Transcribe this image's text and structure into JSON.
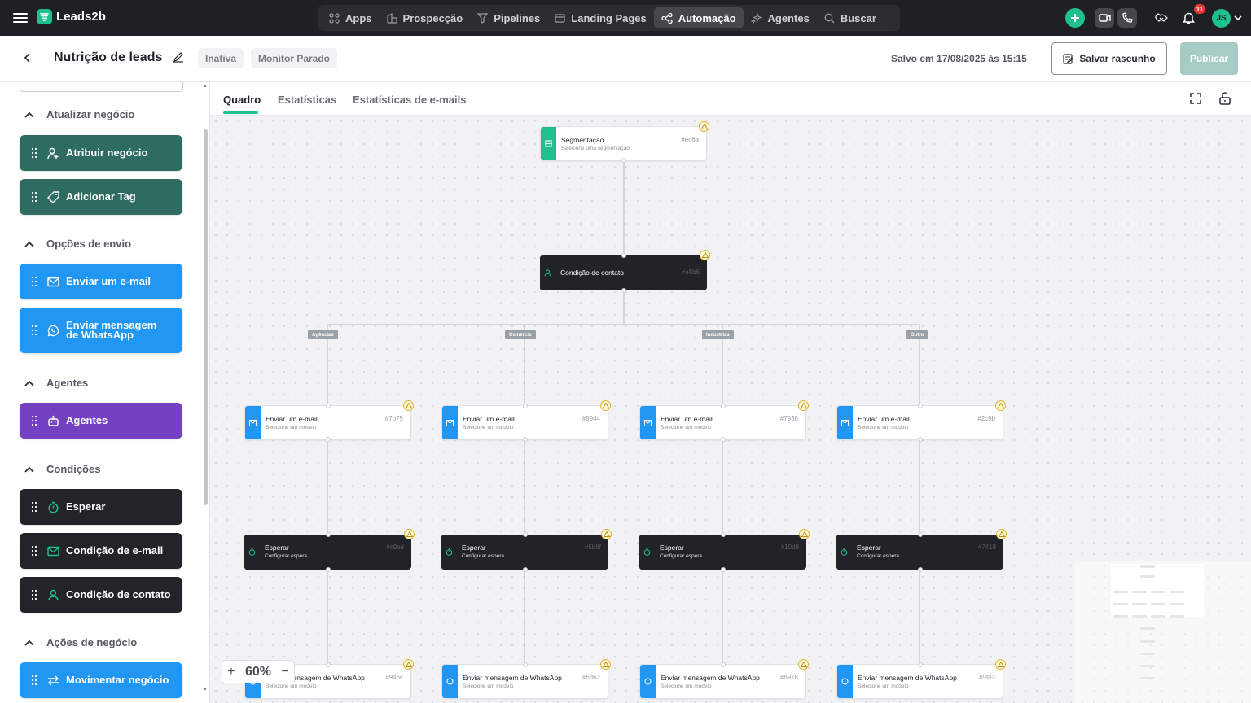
{
  "topbar": {
    "brand": "Leads2b",
    "nav": [
      {
        "label": "Apps",
        "icon": "apps-grid-icon"
      },
      {
        "label": "Prospecção",
        "icon": "building-icon"
      },
      {
        "label": "Pipelines",
        "icon": "filter-icon"
      },
      {
        "label": "Landing Pages",
        "icon": "layout-icon"
      },
      {
        "label": "Automação",
        "icon": "share-nodes-icon",
        "active": true
      },
      {
        "label": "Agentes",
        "icon": "sparkle-icon"
      },
      {
        "label": "Buscar",
        "icon": "search-icon"
      }
    ],
    "notification_count": "11",
    "user_initials": "JS"
  },
  "header": {
    "title": "Nutrição de leads",
    "status_pills": [
      "Inativa",
      "Monitor Parado"
    ],
    "saved_text": "Salvo em 17/08/2025 às 15:15",
    "draft_button": "Salvar rascunho",
    "publish_button": "Publicar"
  },
  "sidebar": {
    "sections": [
      {
        "title": "Atualizar negócio",
        "items": [
          {
            "label": "Atribuir negócio",
            "icon": "user-plus-icon",
            "color": "#2e6b60"
          },
          {
            "label": "Adicionar Tag",
            "icon": "tag-icon",
            "color": "#2e6b60"
          }
        ]
      },
      {
        "title": "Opções de envio",
        "items": [
          {
            "label": "Enviar um e-mail",
            "icon": "mail-icon",
            "color": "#2196f3"
          },
          {
            "label": "Enviar mensagem de WhatsApp",
            "icon": "whatsapp-icon",
            "color": "#2196f3"
          }
        ]
      },
      {
        "title": "Agentes",
        "items": [
          {
            "label": "Agentes",
            "icon": "robot-icon",
            "color": "#7341c2"
          }
        ]
      },
      {
        "title": "Condições",
        "items": [
          {
            "label": "Esperar",
            "icon": "timer-icon",
            "color": "#22242a"
          },
          {
            "label": "Condição de e-mail",
            "icon": "mail-icon",
            "color": "#22242a"
          },
          {
            "label": "Condição de contato",
            "icon": "user-icon",
            "color": "#22242a"
          }
        ]
      },
      {
        "title": "Ações de negócio",
        "items": [
          {
            "label": "Movimentar negócio",
            "icon": "arrows-swap-icon",
            "color": "#2196f3"
          }
        ]
      }
    ]
  },
  "tabs": [
    "Quadro",
    "Estatísticas",
    "Estatísticas de e-mails"
  ],
  "canvas": {
    "zoom": "60%",
    "root": {
      "title": "Segmentação",
      "subtitle": "Selecione uma segmentação",
      "id": "#ec6a",
      "color": "#1fbf8f"
    },
    "condition": {
      "title": "Condição de contato",
      "id": "#e8b6"
    },
    "branches": [
      {
        "label": "Agências",
        "email": {
          "title": "Enviar um e-mail",
          "subtitle": "Selecione um modelo",
          "id": "#7b75"
        },
        "wait": {
          "title": "Esperar",
          "subtitle": "Configurar espera",
          "id": "#c9ed"
        },
        "whatsapp": {
          "title": "Enviar mensagem de WhatsApp",
          "subtitle": "Selecione um modelo",
          "id": "#946c"
        }
      },
      {
        "label": "Comércio",
        "email": {
          "title": "Enviar um e-mail",
          "subtitle": "Selecione um modelo",
          "id": "#9944"
        },
        "wait": {
          "title": "Esperar",
          "subtitle": "Configurar espera",
          "id": "#5b8f"
        },
        "whatsapp": {
          "title": "Enviar mensagem de WhatsApp",
          "subtitle": "Selecione um modelo",
          "id": "#6d62"
        }
      },
      {
        "label": "Industrias",
        "email": {
          "title": "Enviar um e-mail",
          "subtitle": "Selecione um modelo",
          "id": "#7938"
        },
        "wait": {
          "title": "Esperar",
          "subtitle": "Configurar espera",
          "id": "#10d9"
        },
        "whatsapp": {
          "title": "Enviar mensagem de WhatsApp",
          "subtitle": "Selecione um modelo",
          "id": "#b976"
        }
      },
      {
        "label": "Outro",
        "email": {
          "title": "Enviar um e-mail",
          "subtitle": "Selecione um modelo",
          "id": "#2c9b"
        },
        "wait": {
          "title": "Esperar",
          "subtitle": "Configurar espera",
          "id": "#7418"
        },
        "whatsapp": {
          "title": "Enviar mensagem de WhatsApp",
          "subtitle": "Selecione um modelo",
          "id": "#9f02"
        }
      }
    ]
  }
}
